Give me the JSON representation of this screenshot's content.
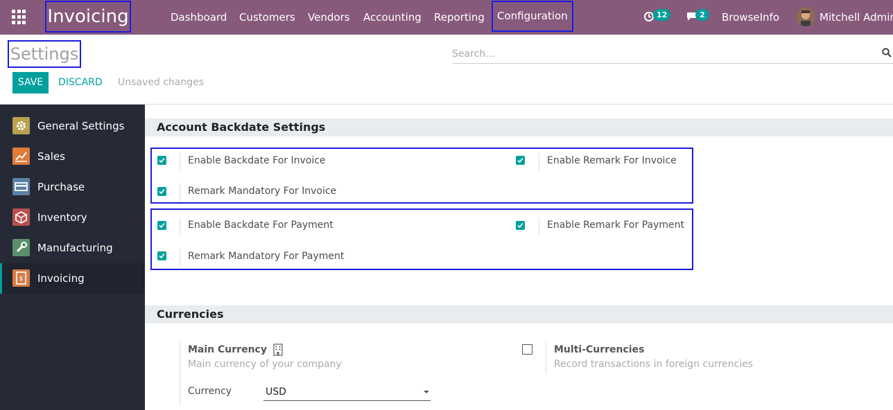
{
  "navbar": {
    "app_name": "Invoicing",
    "menu": [
      "Dashboard",
      "Customers",
      "Vendors",
      "Accounting",
      "Reporting",
      "Configuration"
    ],
    "activity_count": "12",
    "message_count": "2",
    "company": "BrowseInfo",
    "user": "Mitchell Admin",
    "bg_color": "#875a7b"
  },
  "control_panel": {
    "title": "Settings",
    "search_placeholder": "Search...",
    "save_label": "SAVE",
    "discard_label": "DISCARD",
    "status": "Unsaved changes"
  },
  "sidebar": {
    "items": [
      {
        "label": "General Settings",
        "icon": "gear-icon",
        "color": "#b8a24f"
      },
      {
        "label": "Sales",
        "icon": "chart-icon",
        "color": "#e07b39"
      },
      {
        "label": "Purchase",
        "icon": "card-icon",
        "color": "#5b7fa6"
      },
      {
        "label": "Inventory",
        "icon": "box-icon",
        "color": "#b9504d"
      },
      {
        "label": "Manufacturing",
        "icon": "wrench-icon",
        "color": "#5a8f6a"
      },
      {
        "label": "Invoicing",
        "icon": "invoice-icon",
        "color": "#d77b45",
        "active": true
      }
    ]
  },
  "backdate": {
    "section_title": "Account Backdate Settings",
    "invoice": {
      "enable_backdate": "Enable Backdate For Invoice",
      "enable_remark": "Enable Remark For Invoice",
      "remark_mandatory": "Remark Mandatory For Invoice"
    },
    "payment": {
      "enable_backdate": "Enable Backdate For Payment",
      "enable_remark": "Enable Remark For Payment",
      "remark_mandatory": "Remark Mandatory For Payment"
    }
  },
  "currencies": {
    "section_title": "Currencies",
    "main_currency_title": "Main Currency",
    "main_currency_desc": "Main currency of your company",
    "currency_label": "Currency",
    "currency_value": "USD",
    "multi_title": "Multi-Currencies",
    "multi_desc": "Record transactions in foreign currencies"
  },
  "colors": {
    "accent": "#00a09d",
    "highlight": "#1c1ce0"
  }
}
